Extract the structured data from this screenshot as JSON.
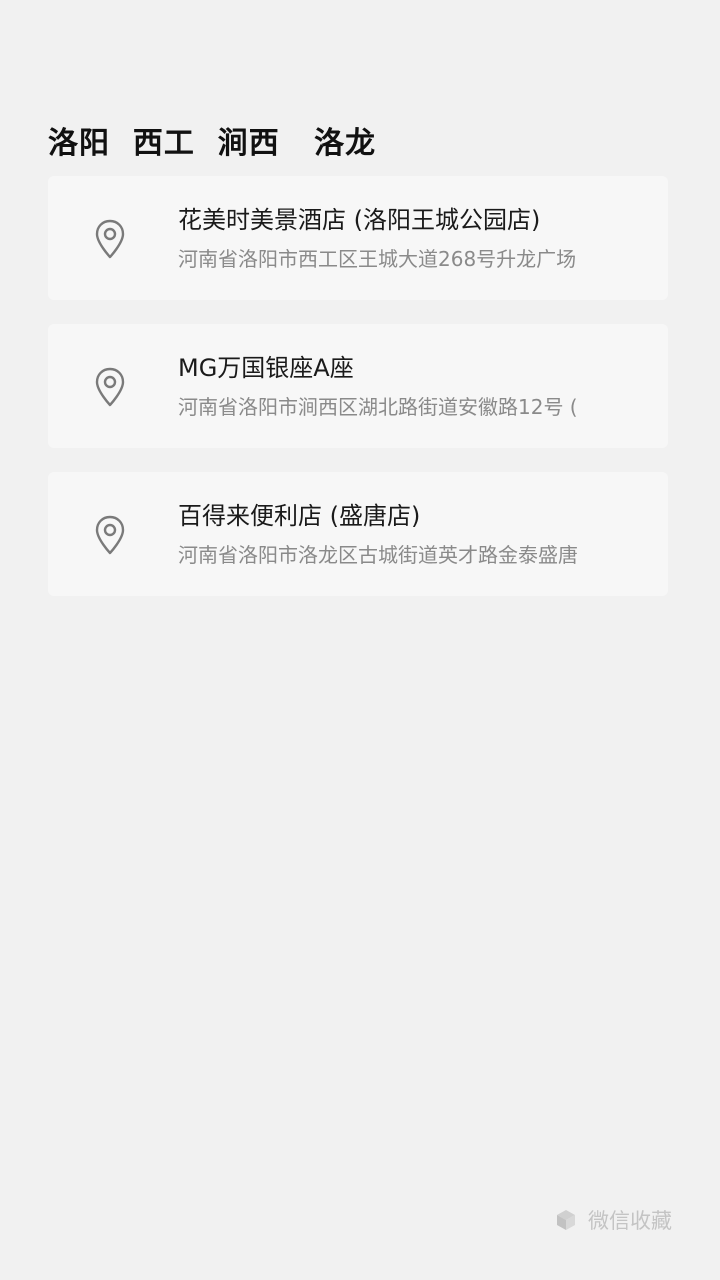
{
  "header": {
    "title": "洛阳  西工  涧西   洛龙"
  },
  "locations": [
    {
      "name": "花美时美景酒店 (洛阳王城公园店)",
      "address": "河南省洛阳市西工区王城大道268号升龙广场",
      "icon": "location-pin-icon"
    },
    {
      "name": "MG万国银座A座",
      "address": "河南省洛阳市涧西区湖北路街道安徽路12号 (",
      "icon": "location-pin-icon"
    },
    {
      "name": "百得来便利店 (盛唐店)",
      "address": "河南省洛阳市洛龙区古城街道英才路金泰盛唐",
      "icon": "location-pin-icon"
    }
  ],
  "footer": {
    "label": "微信收藏",
    "icon": "cube-icon"
  },
  "colors": {
    "background": "#f1f1f1",
    "card": "#f7f7f7",
    "title_text": "#111111",
    "name_text": "#1a1a1a",
    "address_text": "#8a8a8a",
    "footer_text": "#c4c4c4"
  }
}
